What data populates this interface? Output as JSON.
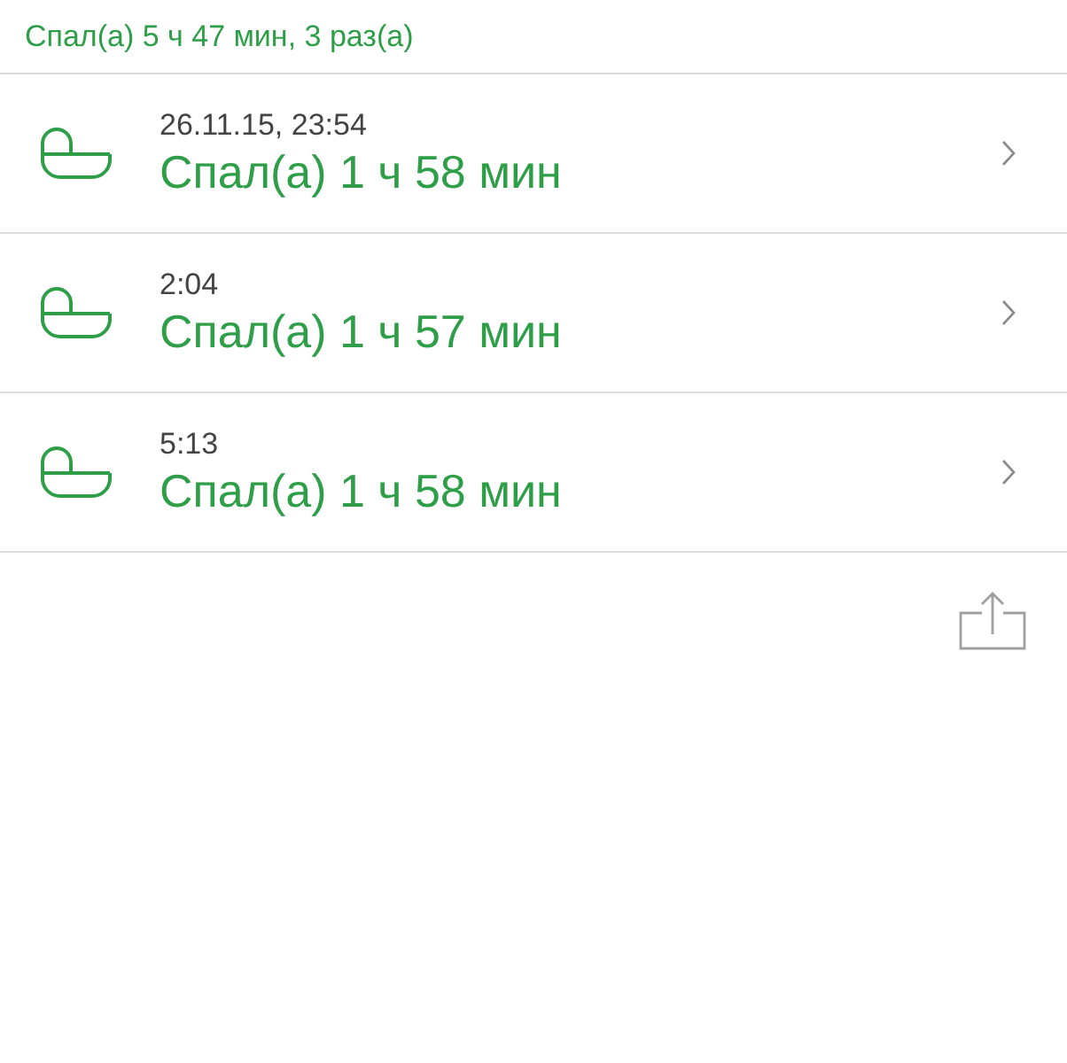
{
  "summary": "Спал(а) 5 ч 47 мин,  3 раз(а)",
  "entries": [
    {
      "time": "26.11.15, 23:54",
      "duration": "Спал(а) 1 ч 58 мин"
    },
    {
      "time": "2:04",
      "duration": "Спал(а) 1 ч 57 мин"
    },
    {
      "time": "5:13",
      "duration": "Спал(а) 1 ч 58 мин"
    }
  ]
}
